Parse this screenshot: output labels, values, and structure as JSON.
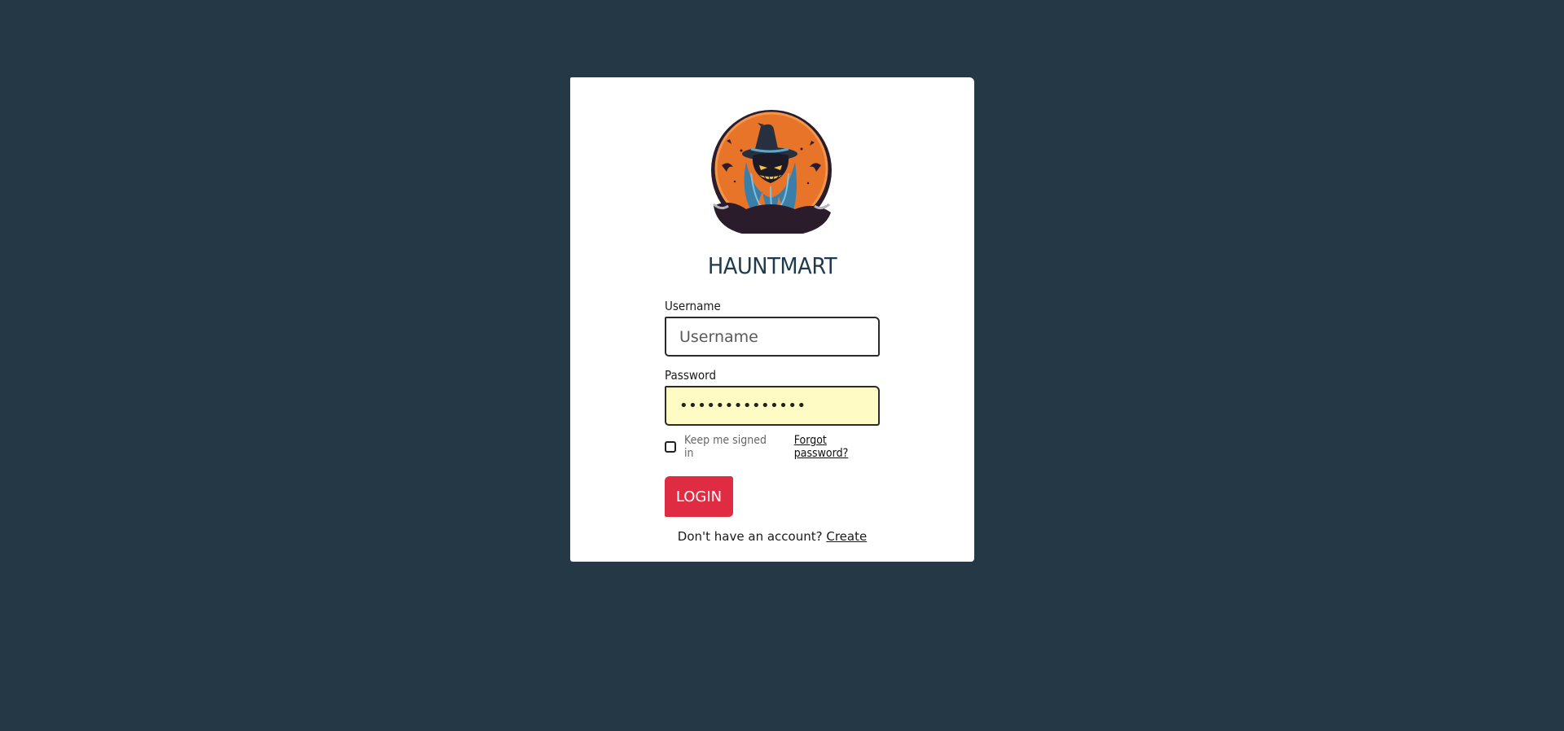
{
  "brand": {
    "name": "HAUNTMART",
    "logo_icon": "witch-pumpkin-logo-icon"
  },
  "form": {
    "username_label": "Username",
    "username_placeholder": "Username",
    "username_value": "",
    "password_label": "Password",
    "password_value": "••••••••••••••",
    "keep_signed_in_label": "Keep me signed in",
    "keep_signed_in_checked": false,
    "forgot_password_label": "Forgot password?",
    "login_label": "LOGIN"
  },
  "signup": {
    "prompt": "Don't have an account?",
    "link_label": "Create"
  },
  "colors": {
    "background": "#253845",
    "card": "#ffffff",
    "brand_text": "#1f3a4c",
    "login_button": "#e02c43",
    "password_autofill": "#fefbc5",
    "logo_orange": "#e8742a"
  }
}
